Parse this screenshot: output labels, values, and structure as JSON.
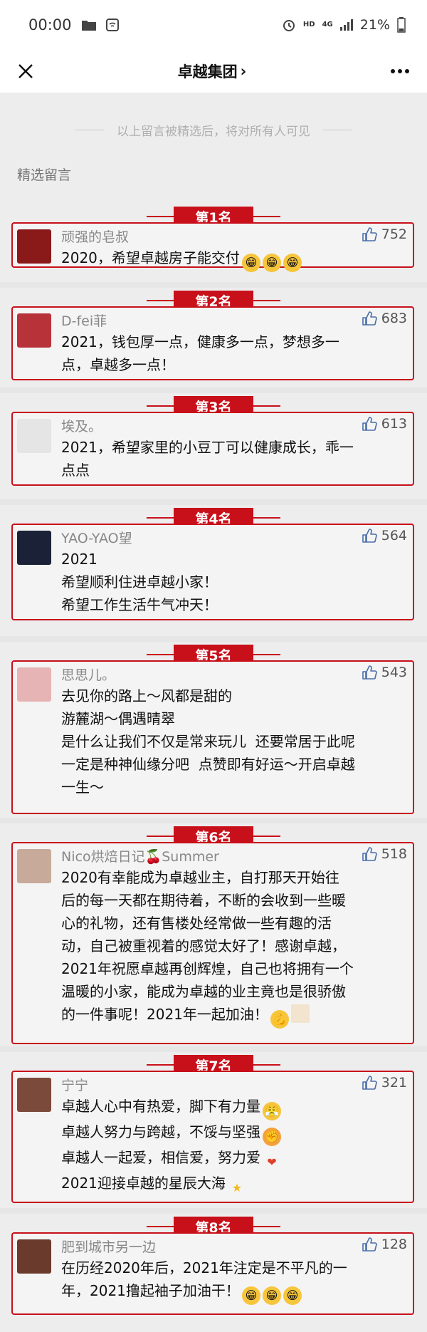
{
  "status": {
    "time": "00:00",
    "hd": "HD",
    "net": "4G",
    "battery": "21%"
  },
  "nav": {
    "title": "卓越集团",
    "chevron": "›"
  },
  "notice": "以上留言被精选后，将对所有人可见",
  "section_label": "精选留言",
  "colors": {
    "accent": "#c8101a",
    "like": "#4a6ea9"
  },
  "entries": [
    {
      "rank": "第1名",
      "name": "顽强的皂叔",
      "likes": "752",
      "text": "2020，希望卓越房子能交付",
      "emoji": [
        "grin",
        "grin",
        "grin"
      ]
    },
    {
      "rank": "第2名",
      "name": "D-fei菲",
      "likes": "683",
      "text": "2021，钱包厚一点，健康多一点，梦想多一\n点，卓越多一点！",
      "emoji": []
    },
    {
      "rank": "第3名",
      "name": "埃及。",
      "likes": "613",
      "text": "2021，希望家里的小豆丁可以健康成长，乖一\n点点",
      "emoji": []
    },
    {
      "rank": "第4名",
      "name": "YAO-YAO望",
      "likes": "564",
      "text": "2021\n希望顺利住进卓越小家！\n希望工作生活牛气冲天！",
      "emoji": []
    },
    {
      "rank": "第5名",
      "name": "思思儿。",
      "likes": "543",
      "text": "去见你的路上～风都是甜的\n游麓湖～偶遇晴翠\n是什么让我们不仅是常来玩儿  还要常居于此呢\n一定是种神仙缘分吧  点赞即有好运～开启卓越\n一生～",
      "emoji": []
    },
    {
      "rank": "第6名",
      "name": "Nico烘焙日记🍒Summer",
      "likes": "518",
      "text": "2020有幸能成为卓越业主，自打那天开始往\n后的每一天都在期待着，不断的会收到一些暖\n心的礼物，还有售楼处经常做一些有趣的活\n动，自己被重视着的感觉太好了！感谢卓越，\n2021年祝愿卓越再创辉煌，自己也将拥有一个\n温暖的小家，能成为卓越的业主竟也是很骄傲\n的一件事呢！2021年一起加油！",
      "emoji": [
        "muscle",
        "blank"
      ]
    },
    {
      "rank": "第7名",
      "name": "宁宁",
      "likes": "321",
      "lines": [
        {
          "t": "卓越人心中有热爱，脚下有力量",
          "e": "fight"
        },
        {
          "t": "卓越人努力与跨越，不馁与坚强",
          "e": "fist"
        },
        {
          "t": "卓越人一起爱，相信爱，努力爱",
          "e": "heart"
        },
        {
          "t": "2021迎接卓越的星辰大海",
          "e": "star"
        }
      ]
    },
    {
      "rank": "第8名",
      "name": "肥到城市另一边",
      "likes": "128",
      "text": "在历经2020年后，2021年注定是不平凡的一\n年，2021撸起袖子加油干！",
      "emoji": [
        "grin",
        "grin",
        "grin"
      ]
    }
  ]
}
